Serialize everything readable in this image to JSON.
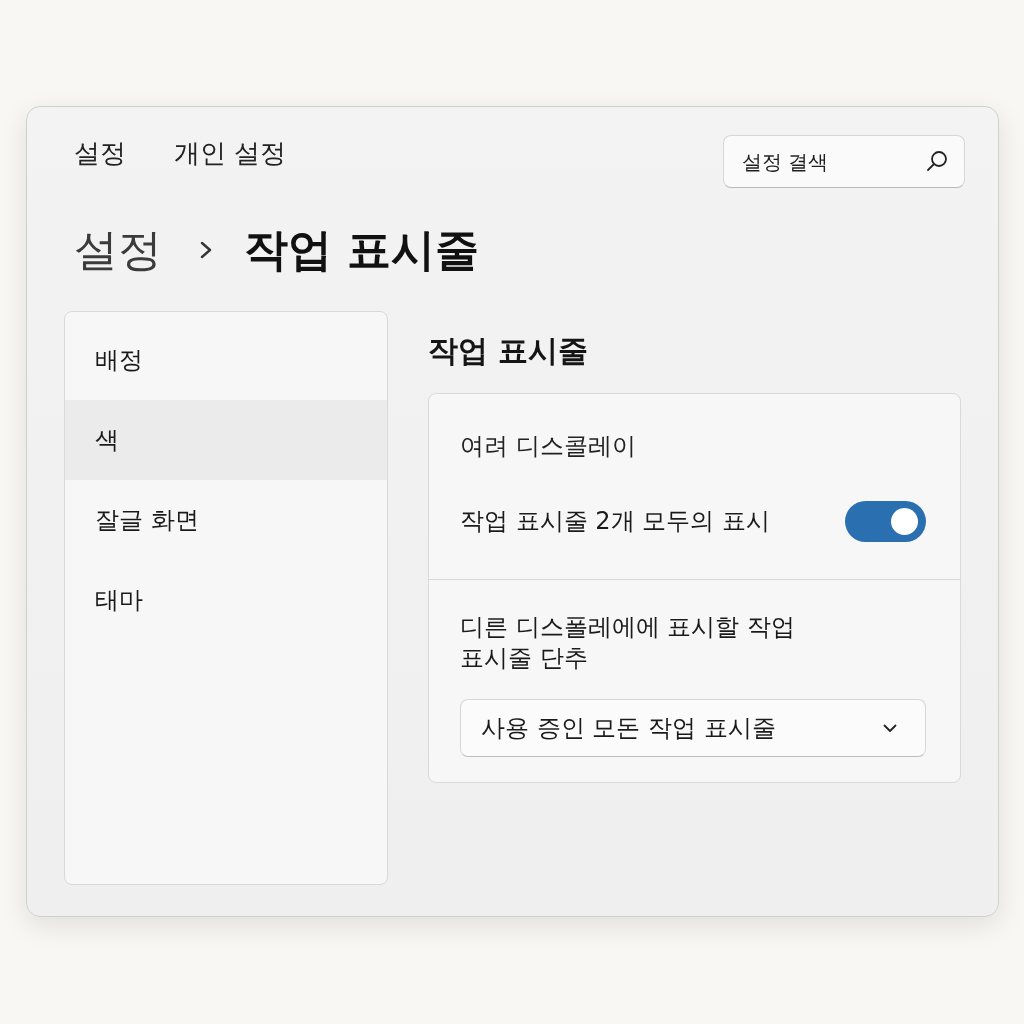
{
  "window": {
    "nav": [
      {
        "label": "설정"
      },
      {
        "label": "개인 설정"
      }
    ],
    "search": {
      "placeholder": "설정 결색"
    }
  },
  "breadcrumb": {
    "parent": "설정",
    "current": "작업 표시줄"
  },
  "sidebar": {
    "items": [
      {
        "label": "배정",
        "selected": false
      },
      {
        "label": "색",
        "selected": true
      },
      {
        "label": "잘글 화면",
        "selected": false
      },
      {
        "label": "태마",
        "selected": false
      }
    ]
  },
  "content": {
    "title": "작업 표시줄",
    "card": {
      "heading": "여려 디스콜레이",
      "rows": [
        {
          "kind": "toggle",
          "label": "작업 표시줄 2개 모두의 표시",
          "on": true
        },
        {
          "kind": "dropdown",
          "label": "디른 디스폴레에에 표시할 작업 표시줄 단추",
          "value": "사용 증인 모돈 작업 표시줄"
        }
      ]
    }
  }
}
